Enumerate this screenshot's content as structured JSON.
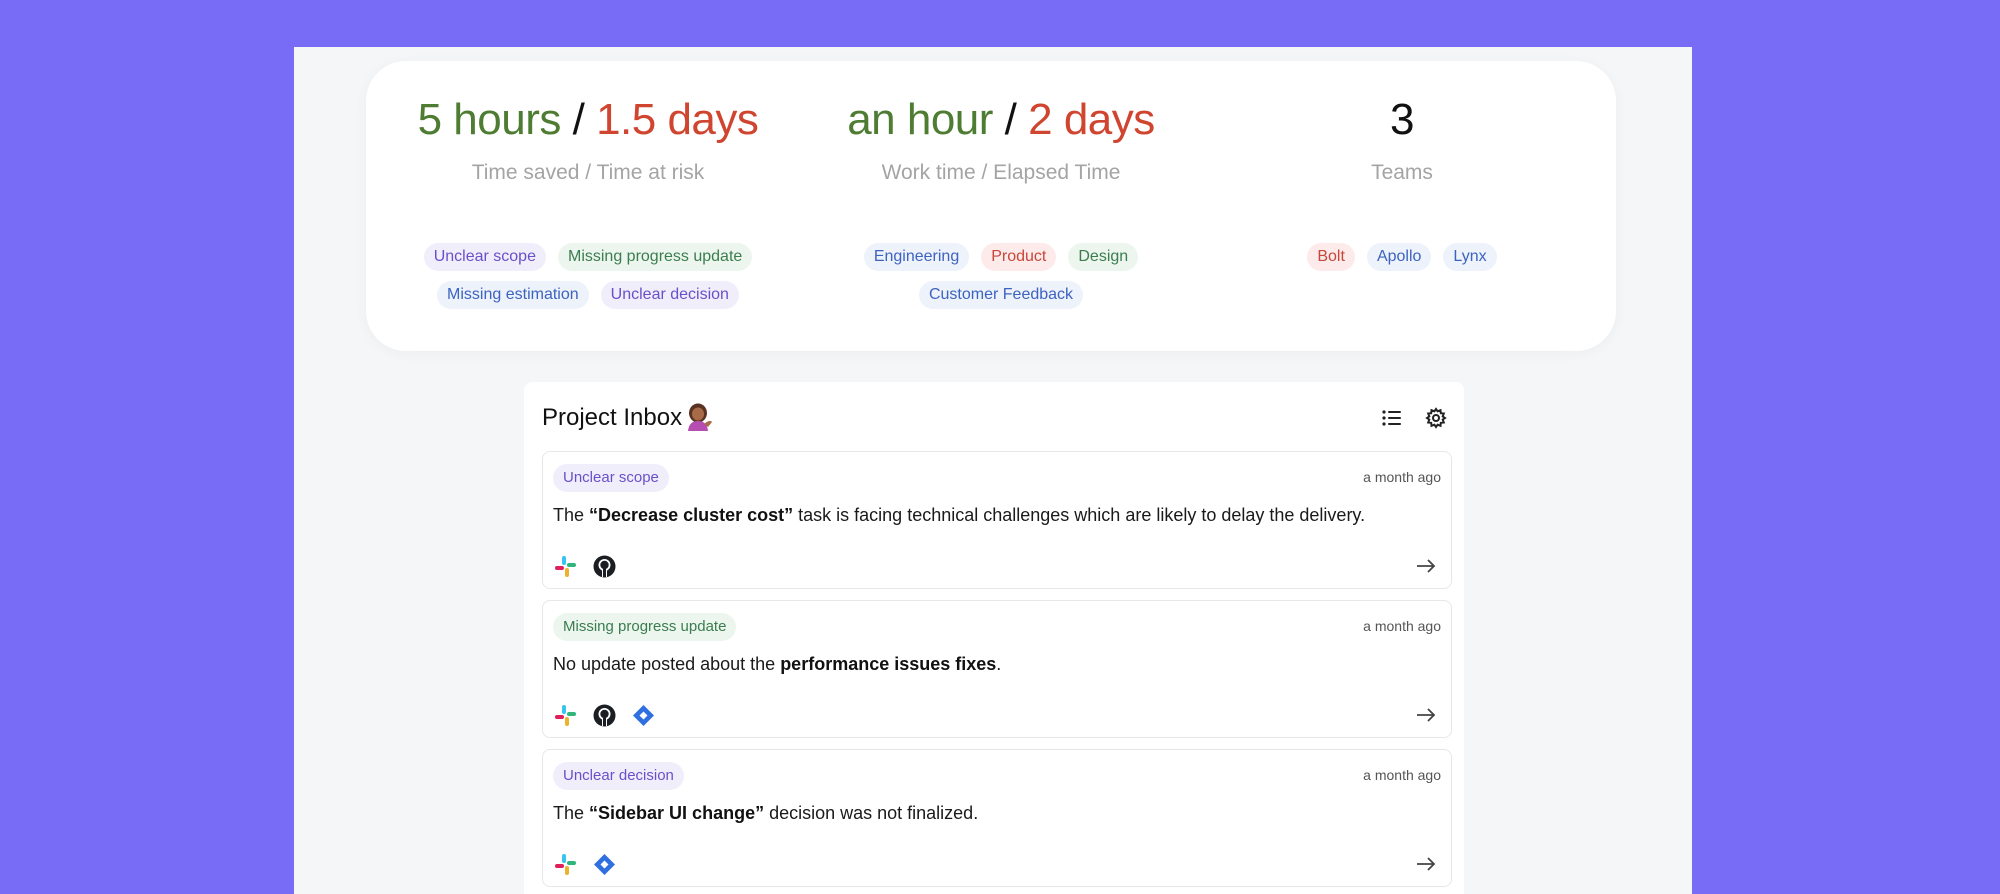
{
  "stats": {
    "time_saved": "5 hours",
    "separator": "/",
    "time_at_risk": "1.5 days",
    "time_caption": "Time saved / Time at risk",
    "work_time": "an hour",
    "elapsed_time": "2 days",
    "work_caption": "Work time / Elapsed Time",
    "teams_count": "3",
    "teams_caption": "Teams",
    "issue_tags": [
      "Unclear scope",
      "Missing progress update",
      "Missing estimation",
      "Unclear decision"
    ],
    "department_tags": [
      "Engineering",
      "Product",
      "Design",
      "Customer Feedback"
    ],
    "team_tags": [
      "Bolt",
      "Apollo",
      "Lynx"
    ]
  },
  "inbox": {
    "title": "Project Inbox",
    "title_emoji": "person-tipping-hand-emoji",
    "items": [
      {
        "tag": "Unclear scope",
        "time": "a month ago",
        "prefix": "The ",
        "highlight": "“Decrease cluster cost”",
        "suffix": " task is facing technical challenges which are likely to delay the delivery.",
        "sources": [
          "slack-icon",
          "github-icon"
        ]
      },
      {
        "tag": "Missing progress update",
        "time": "a month ago",
        "prefix": "No update posted about the ",
        "highlight": "performance issues fixes",
        "suffix": ".",
        "sources": [
          "slack-icon",
          "github-icon",
          "jira-icon"
        ]
      },
      {
        "tag": "Unclear decision",
        "time": "a month ago",
        "prefix": "The ",
        "highlight": "“Sidebar UI change”",
        "suffix": " decision was not finalized.",
        "sources": [
          "slack-icon",
          "jira-icon"
        ]
      }
    ]
  },
  "colors": {
    "background": "#786cf6",
    "saved_green": "#4d7c32",
    "risk_red": "#d0452f",
    "muted_caption": "#a4a4a4"
  }
}
